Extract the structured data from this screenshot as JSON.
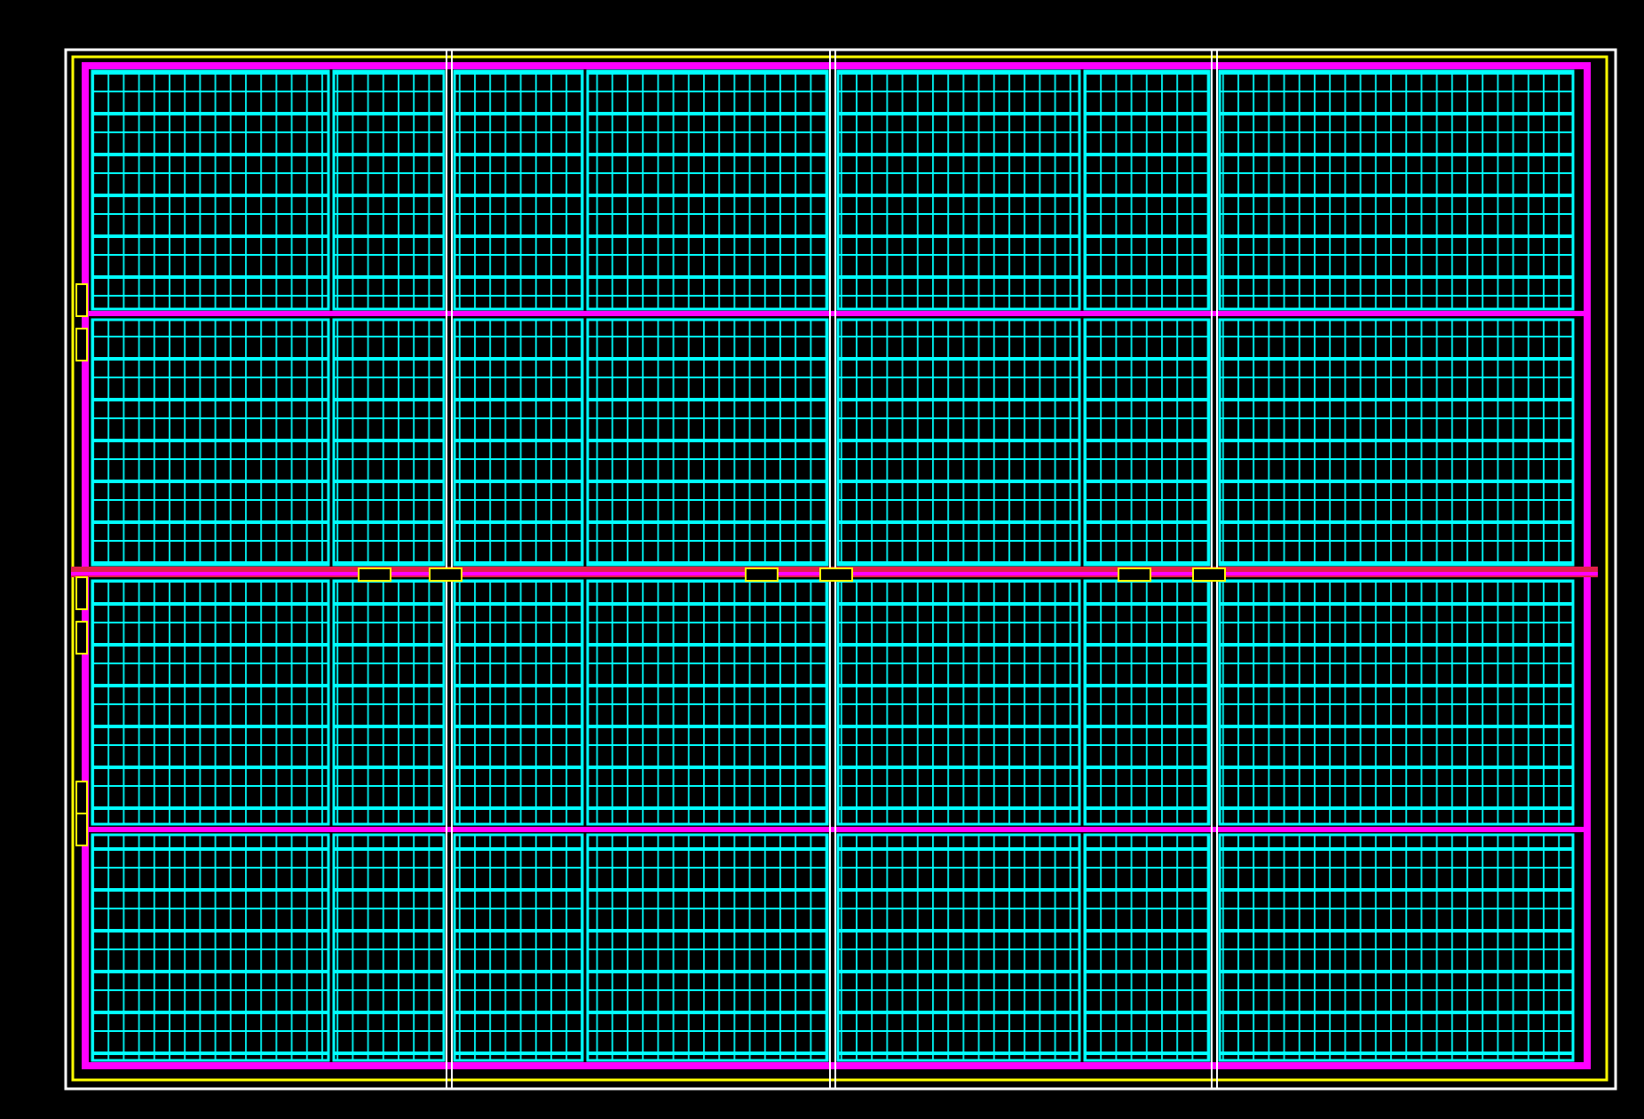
{
  "drawing": {
    "kind": "solar-plan",
    "bands": [
      {
        "kind": "panel-band"
      },
      {
        "kind": "panel-band"
      },
      {
        "kind": "panel-band"
      },
      {
        "kind": "panel-band"
      }
    ]
  }
}
